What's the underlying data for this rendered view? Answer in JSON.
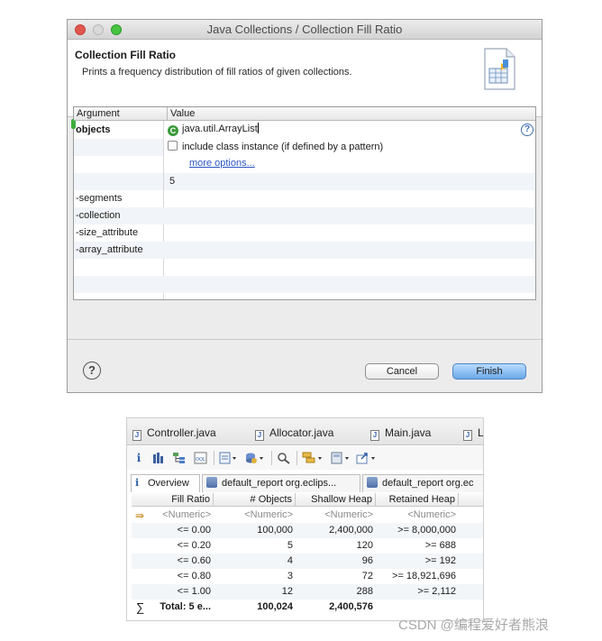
{
  "dialog": {
    "window_title": "Java Collections / Collection Fill Ratio",
    "title": "Collection Fill Ratio",
    "description": "Prints a frequency distribution of fill ratios of given collections.",
    "columns": {
      "argument": "Argument",
      "value": "Value"
    },
    "arguments": [
      "objects",
      "-segments",
      "-collection",
      "-size_attribute",
      "-array_attribute"
    ],
    "objects_value": "java.util.ArrayList",
    "include_class_instance": "include class instance (if defined by a pattern)",
    "more_options": "more options...",
    "segments_value": "5",
    "cancel_label": "Cancel",
    "finish_label": "Finish"
  },
  "editor": {
    "tabs": [
      "Controller.java",
      "Allocator.java",
      "Main.java",
      "L"
    ],
    "subtabs": {
      "overview": "Overview",
      "report1": "default_report  org.eclips...",
      "report2": "default_report  org.ec"
    },
    "table": {
      "headers": [
        "Fill Ratio",
        "# Objects",
        "Shallow Heap",
        "Retained Heap"
      ],
      "filter_row": [
        "<Numeric>",
        "<Numeric>",
        "<Numeric>",
        "<Numeric>"
      ],
      "rows": [
        [
          "<= 0.00",
          "100,000",
          "2,400,000",
          ">= 8,000,000"
        ],
        [
          "<= 0.20",
          "5",
          "120",
          ">= 688"
        ],
        [
          "<= 0.60",
          "4",
          "96",
          ">= 192"
        ],
        [
          "<= 0.80",
          "3",
          "72",
          ">= 18,921,696"
        ],
        [
          "<= 1.00",
          "12",
          "288",
          ">= 2,112"
        ]
      ],
      "total": [
        "Total: 5 e...",
        "100,024",
        "2,400,576",
        ""
      ]
    }
  },
  "watermark": "CSDN @编程爱好者熊浪"
}
